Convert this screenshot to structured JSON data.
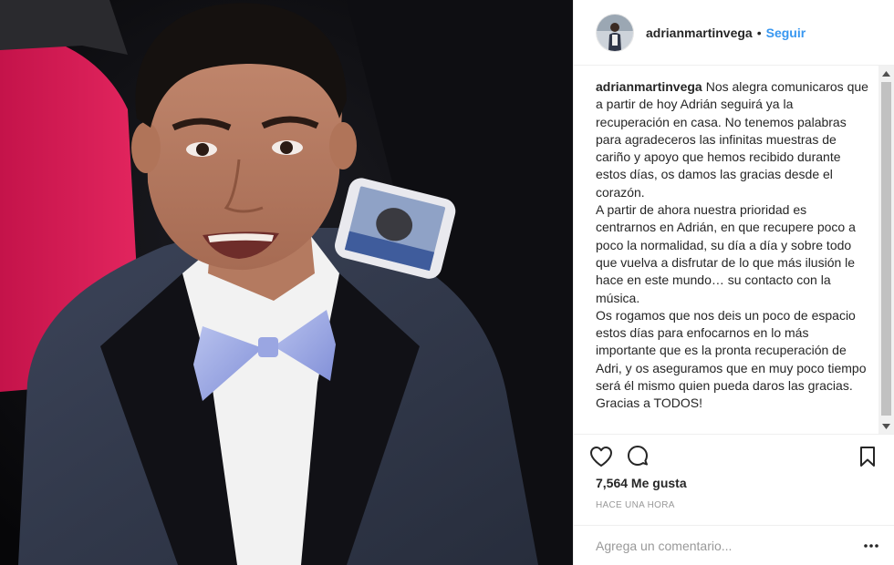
{
  "header": {
    "username": "adrianmartinvega",
    "separator": "•",
    "follow_label": "Seguir"
  },
  "caption": {
    "username": "adrianmartinvega",
    "text": "Nos alegra comunicaros que a partir de hoy Adrián seguirá ya la recuperación en casa. No tenemos palabras para agradeceros las infinitas muestras de cariño y apoyo que hemos recibido durante estos días, os damos las gracias desde el corazón.\nA partir de ahora nuestra prioridad es centrarnos en Adrián, en que recupere poco a poco la normalidad, su día a día y sobre todo que vuelva a disfrutar de lo que más ilusión le hace en este mundo… su contacto con la música.\nOs rogamos que nos deis un poco de espacio estos días para enfocarnos en lo más importante que es la pronta recuperación de Adri, y os aseguramos que en muy poco tiempo será él mismo quien pueda daros las gracias.\nGracias a TODOS!"
  },
  "actions": {
    "like_icon": "heart-icon",
    "comment_icon": "comment-icon",
    "save_icon": "bookmark-icon"
  },
  "likes": {
    "text": "7,564 Me gusta"
  },
  "timestamp": "HACE UNA HORA",
  "comment": {
    "placeholder": "Agrega un comentario...",
    "value": "",
    "more_icon": "more-options-icon"
  },
  "colors": {
    "link": "#3897f0",
    "text": "#262626",
    "muted": "#999999",
    "border": "#efefef"
  }
}
